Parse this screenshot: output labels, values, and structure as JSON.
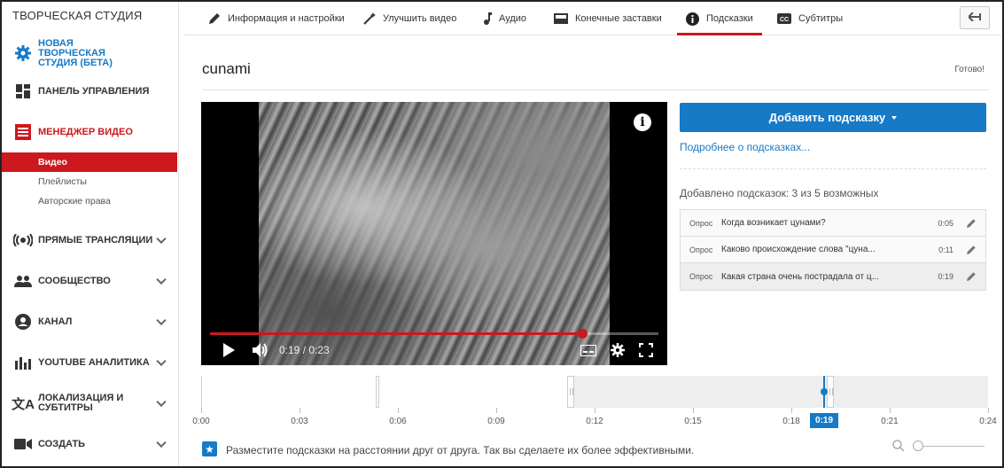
{
  "sidebar": {
    "title": "ТВОРЧЕСКАЯ СТУДИЯ",
    "new_studio": "НОВАЯ ТВОРЧЕСКАЯ СТУДИЯ (БЕТА)",
    "dashboard": "ПАНЕЛЬ УПРАВЛЕНИЯ",
    "video_manager": "МЕНЕДЖЕР ВИДЕО",
    "sub_items": [
      "Видео",
      "Плейлисты",
      "Авторские права"
    ],
    "live": "ПРЯМЫЕ ТРАНСЛЯЦИИ",
    "community": "СООБЩЕСТВО",
    "channel": "КАНАЛ",
    "analytics": "YOUTUBE АНАЛИТИКА",
    "localization": "ЛОКАЛИЗАЦИЯ И СУБТИТРЫ",
    "create": "СОЗДАТЬ"
  },
  "tabs": {
    "info": "Информация и настройки",
    "enhance": "Улучшить видео",
    "audio": "Аудио",
    "end_screens": "Конечные заставки",
    "cards": "Подсказки",
    "subtitles": "Субтитры"
  },
  "video": {
    "title": "cunami",
    "status": "Готово!",
    "time": "0:19 / 0:23",
    "progress": 0.83
  },
  "cards_panel": {
    "add_button": "Добавить подсказку",
    "more_link": "Подробнее о подсказках...",
    "count_text": "Добавлено подсказок: 3 из 5 возможных",
    "items": [
      {
        "type": "Опрос",
        "question": "Когда возникает цунами?",
        "time": "0:05"
      },
      {
        "type": "Опрос",
        "question": "Каково происхождение слова \"цуна...",
        "time": "0:11"
      },
      {
        "type": "Опрос",
        "question": "Какая страна очень пострадала от ц...",
        "time": "0:19"
      }
    ]
  },
  "timeline": {
    "ticks": [
      "0:00",
      "0:03",
      "0:06",
      "0:09",
      "0:12",
      "0:15",
      "0:18",
      "0:21",
      "0:24"
    ],
    "current": "0:19",
    "current_seconds": 19,
    "duration_seconds": 24
  },
  "tip": {
    "text": "Разместите подсказки на расстоянии друг от друга. Так вы сделаете их более эффективными."
  },
  "colors": {
    "accent_blue": "#167ac6",
    "accent_red": "#cc181e"
  }
}
